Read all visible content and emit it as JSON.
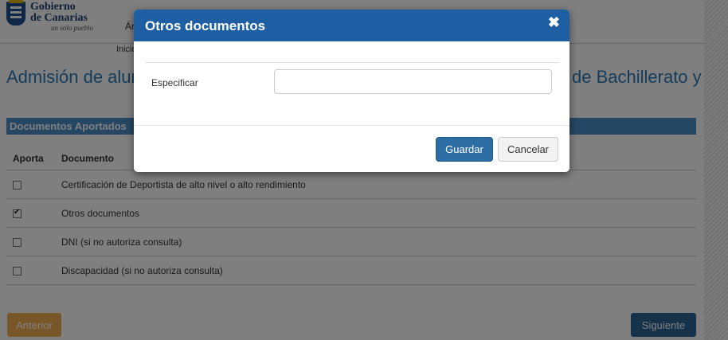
{
  "header": {
    "logo_line1": "Gobierno",
    "logo_line2": "de Canarias",
    "logo_tagline": "un solo pueblo",
    "nav_fragment": "Ár",
    "home_fragment": "Inicio"
  },
  "page": {
    "title_left": "Admisión de alum",
    "title_right": "de Bachillerato y"
  },
  "section": {
    "title": "Documentos Aportados"
  },
  "table": {
    "col_aporta": "Aporta",
    "col_documento": "Documento",
    "rows": [
      {
        "label": "Certificación de Deportista de alto nivel o alto rendimiento",
        "checked": false
      },
      {
        "label": "Otros documentos",
        "checked": true
      },
      {
        "label": "DNI (si no autoriza consulta)",
        "checked": false
      },
      {
        "label": "Discapacidad (si no autoriza consulta)",
        "checked": false
      }
    ]
  },
  "nav": {
    "prev_label": "Anterior",
    "next_label": "Siguiente"
  },
  "modal": {
    "title": "Otros documentos",
    "close_glyph": "✖",
    "field_label": "Especificar",
    "field_value": "",
    "save_label": "Guardar",
    "cancel_label": "Cancelar"
  },
  "colors": {
    "brand_blue": "#1e5fa3",
    "section_blue": "#4a8fc7",
    "prev_orange": "#f0ad4e",
    "next_blue": "#2a6496"
  }
}
